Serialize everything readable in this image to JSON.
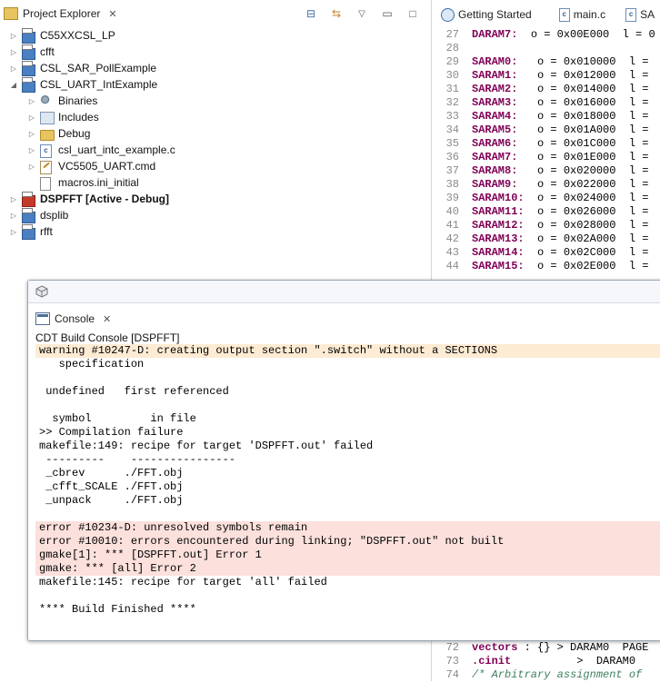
{
  "project_explorer": {
    "title": "Project Explorer",
    "items": [
      {
        "label": "C55XXCSL_LP"
      },
      {
        "label": "cfft"
      },
      {
        "label": "CSL_SAR_PollExample"
      },
      {
        "label": "CSL_UART_IntExample"
      },
      {
        "label": "Binaries"
      },
      {
        "label": "Includes"
      },
      {
        "label": "Debug"
      },
      {
        "label": "csl_uart_intc_example.c"
      },
      {
        "label": "VC5505_UART.cmd"
      },
      {
        "label": "macros.ini_initial"
      },
      {
        "label": "DSPFFT  [Active - Debug]"
      },
      {
        "label": "dsplib"
      },
      {
        "label": "rfft"
      }
    ]
  },
  "editor": {
    "tabs": [
      {
        "label": "Getting Started"
      },
      {
        "label": "main.c"
      },
      {
        "label": "SA"
      }
    ],
    "lines": [
      {
        "num": "27",
        "text": "DARAM7:  o = 0x00E000  l = 0"
      },
      {
        "num": "28",
        "text": ""
      },
      {
        "num": "29",
        "text": "SARAM0:   o = 0x010000  l ="
      },
      {
        "num": "30",
        "text": "SARAM1:   o = 0x012000  l ="
      },
      {
        "num": "31",
        "text": "SARAM2:   o = 0x014000  l ="
      },
      {
        "num": "32",
        "text": "SARAM3:   o = 0x016000  l ="
      },
      {
        "num": "33",
        "text": "SARAM4:   o = 0x018000  l ="
      },
      {
        "num": "34",
        "text": "SARAM5:   o = 0x01A000  l ="
      },
      {
        "num": "35",
        "text": "SARAM6:   o = 0x01C000  l ="
      },
      {
        "num": "36",
        "text": "SARAM7:   o = 0x01E000  l ="
      },
      {
        "num": "37",
        "text": "SARAM8:   o = 0x020000  l ="
      },
      {
        "num": "38",
        "text": "SARAM9:   o = 0x022000  l ="
      },
      {
        "num": "39",
        "text": "SARAM10:  o = 0x024000  l ="
      },
      {
        "num": "40",
        "text": "SARAM11:  o = 0x026000  l ="
      },
      {
        "num": "41",
        "text": "SARAM12:  o = 0x028000  l ="
      },
      {
        "num": "42",
        "text": "SARAM13:  o = 0x02A000  l ="
      },
      {
        "num": "43",
        "text": "SARAM14:  o = 0x02C000  l ="
      },
      {
        "num": "44",
        "text": "SARAM15:  o = 0x02E000  l ="
      }
    ],
    "bottom_lines": [
      {
        "num": "72",
        "text": "vectors : {} > DARAM0  PAGE"
      },
      {
        "num": "73",
        "text": ".cinit          >  DARAM0"
      },
      {
        "num": "74",
        "text": "/* Arbitrary assignment of"
      }
    ]
  },
  "console": {
    "tab_label": "Console",
    "subtitle": "CDT Build Console [DSPFFT]",
    "lines": [
      {
        "text": "warning #10247-D: creating output section \".switch\" without a SECTIONS",
        "kind": "warn"
      },
      {
        "text": "   specification",
        "kind": ""
      },
      {
        "text": "",
        "kind": ""
      },
      {
        "text": " undefined   first referenced",
        "kind": ""
      },
      {
        "text": "",
        "kind": ""
      },
      {
        "text": "  symbol         in file",
        "kind": ""
      },
      {
        "text": ">> Compilation failure",
        "kind": ""
      },
      {
        "text": "makefile:149: recipe for target 'DSPFFT.out' failed",
        "kind": ""
      },
      {
        "text": " ---------    ----------------",
        "kind": ""
      },
      {
        "text": " _cbrev      ./FFT.obj",
        "kind": ""
      },
      {
        "text": " _cfft_SCALE ./FFT.obj",
        "kind": ""
      },
      {
        "text": " _unpack     ./FFT.obj",
        "kind": ""
      },
      {
        "text": "",
        "kind": ""
      },
      {
        "text": "error #10234-D: unresolved symbols remain",
        "kind": "err"
      },
      {
        "text": "error #10010: errors encountered during linking; \"DSPFFT.out\" not built",
        "kind": "err"
      },
      {
        "text": "gmake[1]: *** [DSPFFT.out] Error 1",
        "kind": "err"
      },
      {
        "text": "gmake: *** [all] Error 2",
        "kind": "err"
      },
      {
        "text": "makefile:145: recipe for target 'all' failed",
        "kind": ""
      },
      {
        "text": "",
        "kind": ""
      },
      {
        "text": "**** Build Finished ****",
        "kind": ""
      }
    ]
  }
}
